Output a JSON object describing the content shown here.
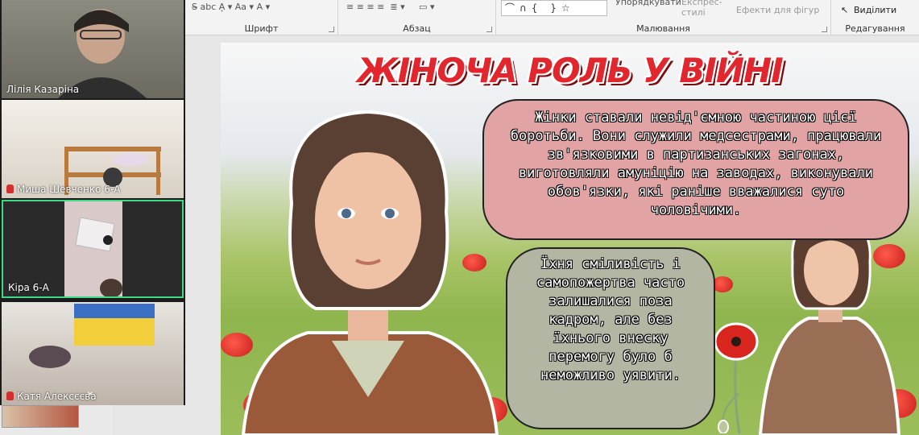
{
  "ribbon": {
    "groups": [
      {
        "label": "Шрифт"
      },
      {
        "label": "Абзац"
      },
      {
        "label": "Малювання"
      },
      {
        "label": "Редагування"
      }
    ],
    "arrange_label": "Упорядкувати",
    "quick_styles_label": "Експрес-стилі",
    "shape_effects_label": "Ефекти для фігур",
    "select_label": "Виділити",
    "shape_glyphs": "⌒∩{ }☆"
  },
  "participants": [
    {
      "name": "Лілія Казаріна",
      "muted": false
    },
    {
      "name": "Миша Шевченко 6-А",
      "muted": true
    },
    {
      "name": "Кіра 6-А",
      "muted": false
    },
    {
      "name": "Катя Алексєєва",
      "muted": true
    }
  ],
  "slide": {
    "title": "ЖІНОЧА РОЛЬ У ВІЙНІ",
    "bubble_1": "Жінки ставали невід'ємною частиною цієї боротьби. Вони служили медсестрами, працювали зв'язковими в партизанських загонах, виготовляли амуніцію на заводах, виконували обов'язки, які раніше вважалися суто чоловічими.",
    "bubble_2": "Їхня сміливість і самопожертва часто залишалися поза кадром, але без їхнього внеску перемогу було б неможливо уявити."
  },
  "colors": {
    "title_red": "#e2262d",
    "bubble_pink": "#e2a3a5",
    "bubble_grey": "#b3b6a2",
    "active_speaker_border": "#3ddc84"
  }
}
